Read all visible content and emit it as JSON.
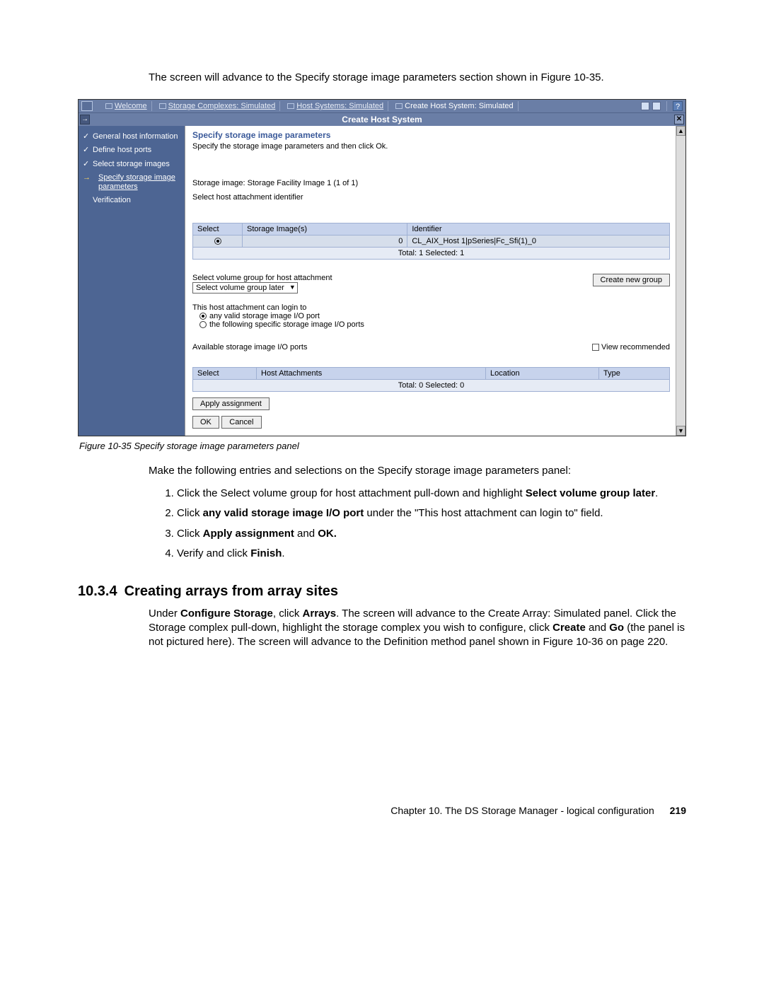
{
  "intro": "The screen will advance to the Specify storage image parameters section shown in Figure 10-35.",
  "tabs": {
    "welcome": "Welcome",
    "storage_complexes": "Storage Complexes: Simulated",
    "host_systems": "Host Systems: Simulated",
    "create_host": "Create Host System: Simulated"
  },
  "title_bar": "Create Host System",
  "sidebar": {
    "general": "General host information",
    "define_ports": "Define host ports",
    "select_images": "Select storage images",
    "specify_params": "Specify storage image parameters",
    "verification": "Verification"
  },
  "panel": {
    "heading": "Specify storage image parameters",
    "sub": "Specify the storage image parameters and then click Ok.",
    "storage_image_label": "Storage image: Storage Facility Image 1 (1 of 1)",
    "select_host_label": "Select host attachment identifier",
    "table1": {
      "h_select": "Select",
      "h_images": "Storage Image(s)",
      "h_ident": "Identifier",
      "row_images": "0",
      "row_ident": "CL_AIX_Host 1|pSeries|Fc_Sfi(1)_0",
      "footer": "Total: 1   Selected: 1"
    },
    "volgroup_label": "Select volume group for host attachment",
    "volgroup_value": "Select volume group later",
    "create_group_btn": "Create new group",
    "login_label": "This host attachment can login to",
    "login_opt1": "any valid storage image I/O port",
    "login_opt2": "the following specific storage image I/O ports",
    "avail_ports": "Available storage image I/O ports",
    "view_rec": "View recommended",
    "table2": {
      "h_select": "Select",
      "h_host": "Host Attachments",
      "h_loc": "Location",
      "h_type": "Type",
      "footer": "Total: 0   Selected: 0"
    },
    "apply_btn": "Apply assignment",
    "ok_btn": "OK",
    "cancel_btn": "Cancel"
  },
  "figure_caption": "Figure 10-35   Specify storage image parameters panel",
  "para_make": "Make the following entries and selections on the Specify storage image parameters panel:",
  "steps": {
    "s1a": "Click the Select volume group for host attachment pull-down and highlight ",
    "s1b": "Select volume group later",
    "s1c": ".",
    "s2a": "Click ",
    "s2b": "any valid storage image I/O port",
    "s2c": " under the \"This host attachment can login to\" field.",
    "s3a": "Click ",
    "s3b": "Apply assignment",
    "s3c": " and ",
    "s3d": "OK.",
    "s4a": "Verify and click ",
    "s4b": "Finish",
    "s4c": "."
  },
  "section_number": "10.3.4",
  "section_title": "Creating arrays from array sites",
  "paragraph2_a": "Under ",
  "paragraph2_b": "Configure Storage",
  "paragraph2_c": ", click ",
  "paragraph2_d": "Arrays",
  "paragraph2_e": ". The screen will advance to the Create Array: Simulated panel. Click the Storage complex pull-down, highlight the storage complex you wish to configure, click ",
  "paragraph2_f": "Create",
  "paragraph2_g": " and ",
  "paragraph2_h": "Go",
  "paragraph2_i": " (the panel is not pictured here). The screen will advance to the Definition method panel shown in Figure 10-36 on page 220.",
  "footer_chapter": "Chapter 10. The DS Storage Manager - logical configuration",
  "footer_page": "219"
}
